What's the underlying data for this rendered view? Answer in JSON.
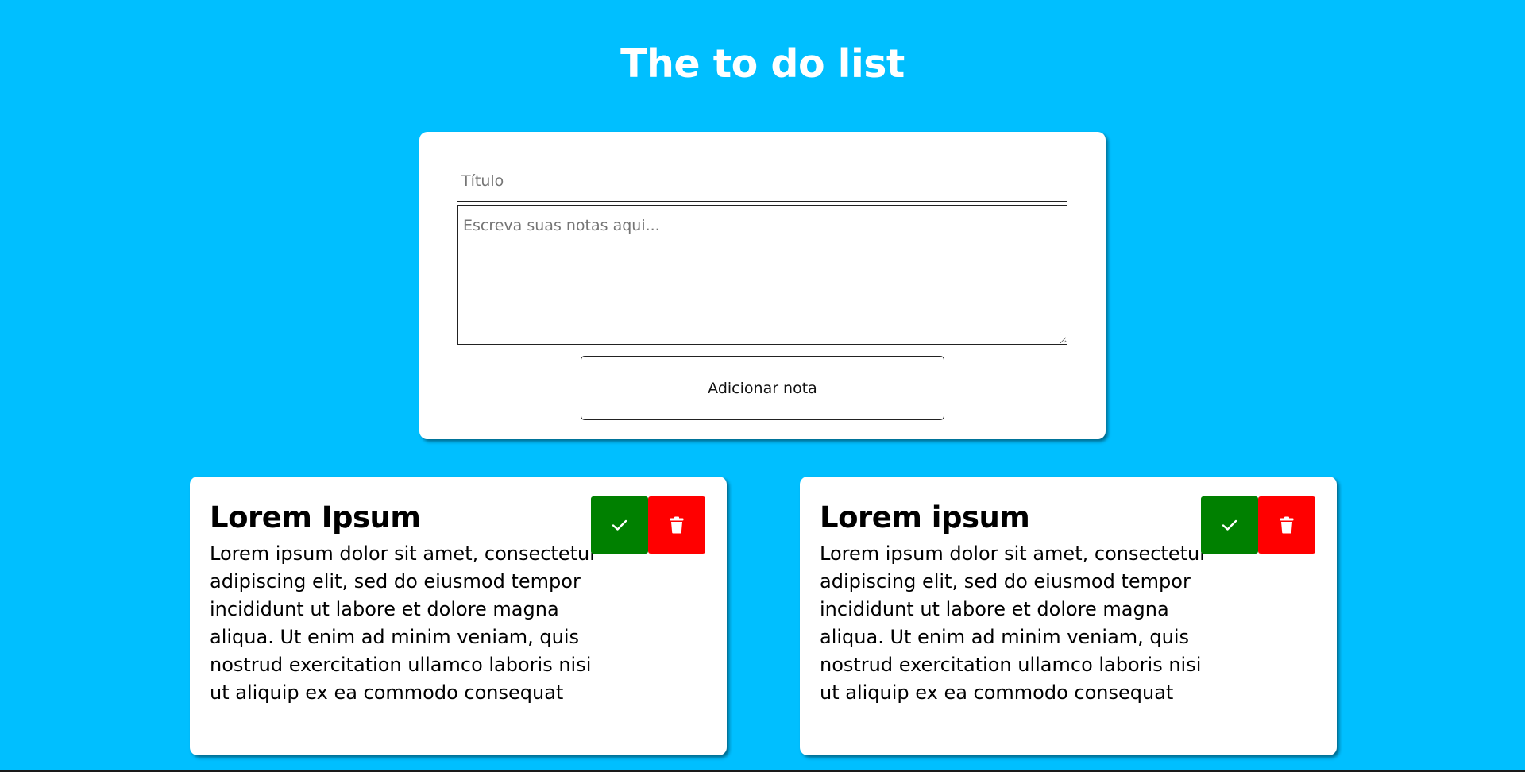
{
  "header": {
    "title": "The to do list"
  },
  "form": {
    "title_placeholder": "Título",
    "title_value": "",
    "notes_placeholder": "Escreva suas notas aqui...",
    "notes_value": "",
    "add_button_label": "Adicionar nota"
  },
  "notes": [
    {
      "title": "Lorem Ipsum",
      "body": "Lorem ipsum dolor sit amet, consectetur adipiscing elit, sed do eiusmod tempor incididunt ut labore et dolore magna aliqua. Ut enim ad minim veniam, quis nostrud exercitation ullamco laboris nisi ut aliquip ex ea commodo consequat",
      "complete_icon": "check-icon",
      "delete_icon": "trash-icon"
    },
    {
      "title": "Lorem ipsum",
      "body": "Lorem ipsum dolor sit amet, consectetur adipiscing elit, sed do eiusmod tempor incididunt ut labore et dolore magna aliqua. Ut enim ad minim veniam, quis nostrud exercitation ullamco laboris nisi ut aliquip ex ea commodo consequat",
      "complete_icon": "check-icon",
      "delete_icon": "trash-icon"
    }
  ],
  "colors": {
    "background": "#00bfff",
    "complete": "#008000",
    "delete": "#ff0000"
  }
}
